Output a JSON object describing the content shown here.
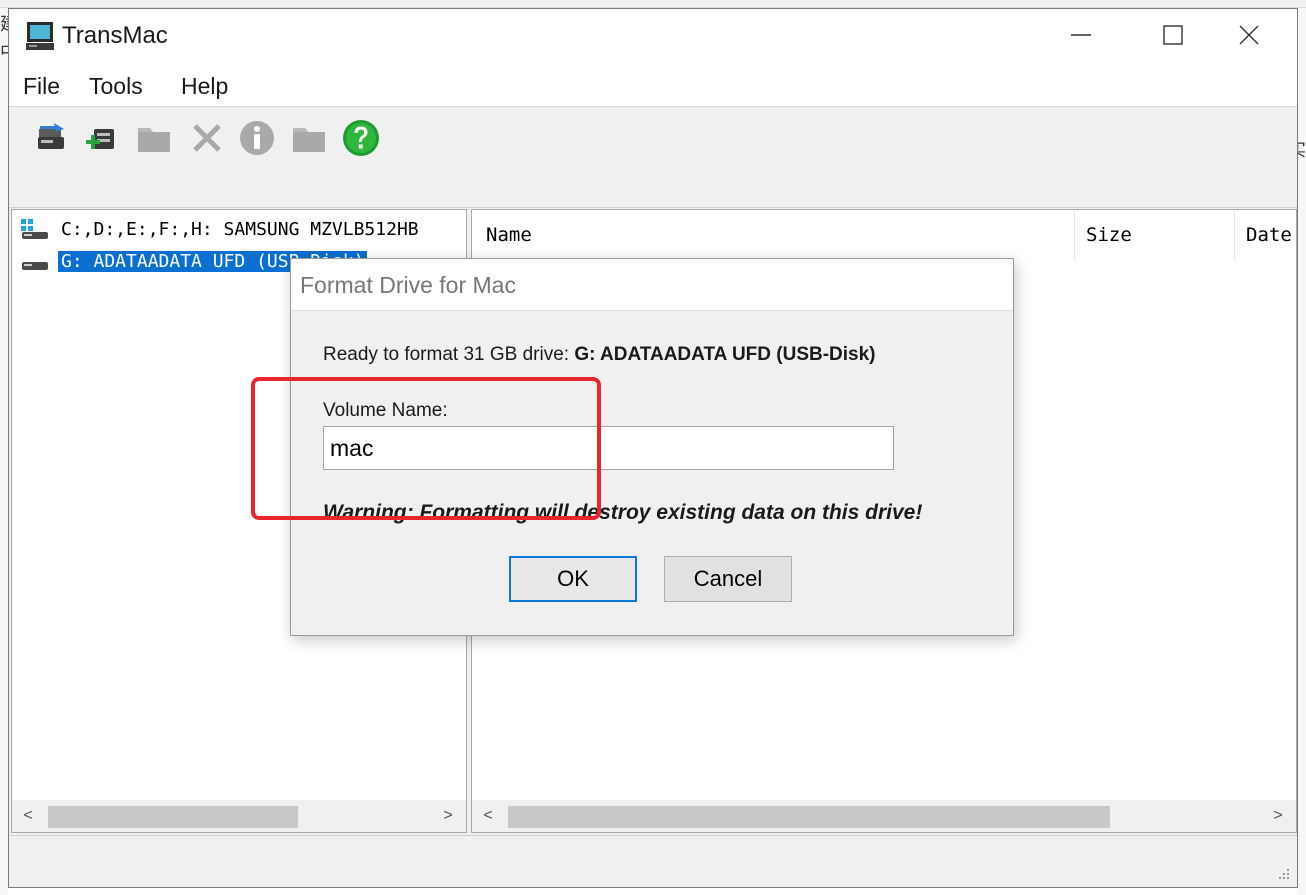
{
  "background": {
    "left_glyphs": [
      "建",
      "中"
    ],
    "right_glyph": "实"
  },
  "window": {
    "title": "TransMac",
    "app_icon": "computer-icon",
    "controls": [
      "minimize-icon",
      "maximize-icon",
      "close-icon"
    ]
  },
  "menu": {
    "items": [
      {
        "label": "File"
      },
      {
        "label": "Tools"
      },
      {
        "label": "Help"
      }
    ]
  },
  "toolbar": {
    "buttons": [
      {
        "icon": "refresh-drive-icon",
        "enabled": true
      },
      {
        "icon": "add-drive-icon",
        "enabled": true
      },
      {
        "icon": "folder-icon",
        "enabled": false
      },
      {
        "icon": "delete-icon",
        "enabled": false
      },
      {
        "icon": "info-icon",
        "enabled": false
      },
      {
        "icon": "folder-icon",
        "enabled": false
      },
      {
        "icon": "help-icon",
        "enabled": true
      }
    ]
  },
  "tree": {
    "items": [
      {
        "label": "C:,D:,E:,F:,H: SAMSUNG MZVLB512HB",
        "icon": "system-drive-icon",
        "selected": false
      },
      {
        "label": "G: ADATAADATA UFD (USB-Disk)",
        "icon": "usb-drive-icon",
        "selected": true
      }
    ]
  },
  "file_list": {
    "columns": [
      {
        "label": "Name"
      },
      {
        "label": "Size"
      },
      {
        "label": "Date"
      }
    ]
  },
  "dialog": {
    "title": "Format Drive for Mac",
    "ready_prefix": "Ready to format 31 GB drive: ",
    "drive_name": "G: ADATAADATA UFD (USB-Disk)",
    "volume_label": "Volume Name:",
    "volume_value": "mac",
    "warning": "Warning: Formatting will destroy existing data on this drive!",
    "ok_label": "OK",
    "cancel_label": "Cancel"
  },
  "colors": {
    "selection": "#0a6fd1",
    "highlight": "#e8262b",
    "ok_border": "#0a78d7"
  }
}
